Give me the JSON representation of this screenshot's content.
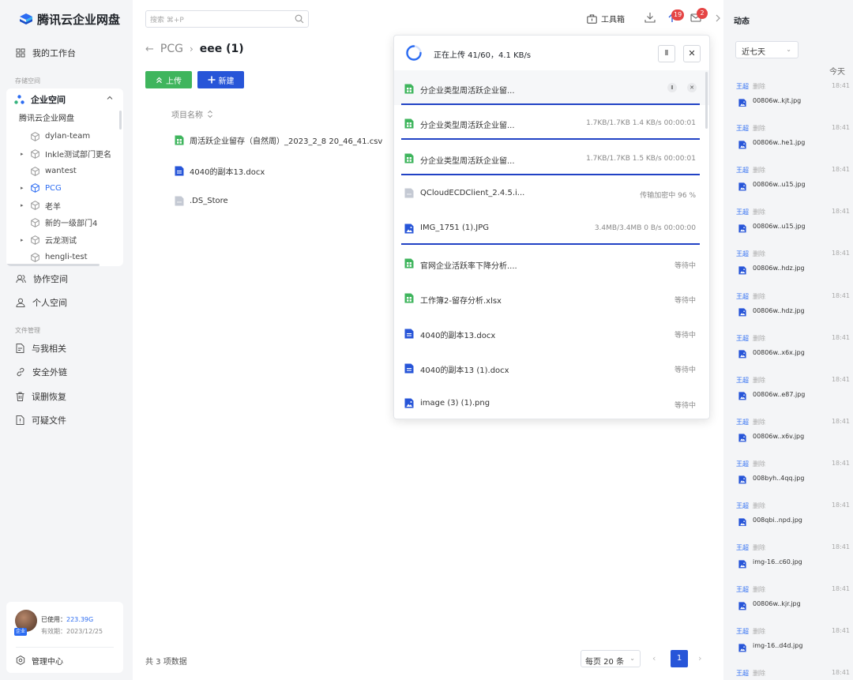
{
  "app": {
    "title": "腾讯云企业网盘"
  },
  "sidebar": {
    "workbench": "我的工作台",
    "storage_label": "存储空间",
    "enterprise_space": "企业空间",
    "tree_root": "腾讯云企业网盘",
    "tree": [
      {
        "label": "dylan-team",
        "arrow": ""
      },
      {
        "label": "Inkle测试部门更名",
        "arrow": "▸"
      },
      {
        "label": "wantest",
        "arrow": ""
      },
      {
        "label": "PCG",
        "arrow": "▸",
        "selected": true
      },
      {
        "label": "老羊",
        "arrow": "▸"
      },
      {
        "label": "新的一级部门4",
        "arrow": ""
      },
      {
        "label": "云龙测试",
        "arrow": "▸"
      },
      {
        "label": "hengli-test",
        "arrow": ""
      }
    ],
    "collab_space": "协作空间",
    "personal_space": "个人空间",
    "file_mgmt_label": "文件管理",
    "related": "与我相关",
    "secure_links": "安全外链",
    "recycle": "误删恢复",
    "suspicious": "可疑文件",
    "user": {
      "used_label": "已使用：",
      "used_value": "223.39G",
      "expire": "有效期：2023/12/25",
      "badge": "企业"
    },
    "admin_center": "管理中心"
  },
  "header": {
    "search_placeholder": "搜索 ⌘+P",
    "toolbox": "工具箱",
    "upload_badge": "19",
    "message_badge": "2"
  },
  "breadcrumb": {
    "parent": "PCG",
    "current": "eee (1)"
  },
  "actions": {
    "upload": "上传",
    "new": "新建"
  },
  "files": {
    "column_name": "项目名称",
    "items": [
      {
        "name": "周活跃企业留存（自然周）_2023_2_8 20_46_41.csv",
        "type": "sheet"
      },
      {
        "name": "4040的副本13.docx",
        "type": "doc"
      },
      {
        "name": ".DS_Store",
        "type": "other"
      }
    ],
    "total": "共 3 项数据"
  },
  "pagination": {
    "page_size": "每页 20 条",
    "current_page": "1"
  },
  "upload_panel": {
    "status": "正在上传 41/60，4.1 KB/s",
    "items": [
      {
        "name": "分企业类型周活跃企业留...",
        "status": "",
        "type": "sheet",
        "progress": 1,
        "controls": true
      },
      {
        "name": "分企业类型周活跃企业留...",
        "status": "1.7KB/1.7KB 1.4 KB/s 00:00:01",
        "type": "sheet",
        "progress": 1
      },
      {
        "name": "分企业类型周活跃企业留...",
        "status": "1.7KB/1.7KB 1.5 KB/s 00:00:01",
        "type": "sheet",
        "progress": 1
      },
      {
        "name": "QCloudECDClient_2.4.5.i...",
        "status": "传输加密中 96 %",
        "type": "other",
        "progress": 0
      },
      {
        "name": "IMG_1751 (1).JPG",
        "status": "3.4MB/3.4MB 0 B/s 00:00:00",
        "type": "image",
        "progress": 1
      },
      {
        "name": "官网企业活跃率下降分析....",
        "status": "等待中",
        "type": "sheet",
        "progress": 0
      },
      {
        "name": "工作簿2-留存分析.xlsx",
        "status": "等待中",
        "type": "sheet",
        "progress": 0
      },
      {
        "name": "4040的副本13.docx",
        "status": "等待中",
        "type": "doc",
        "progress": 0
      },
      {
        "name": "4040的副本13 (1).docx",
        "status": "等待中",
        "type": "doc",
        "progress": 0
      },
      {
        "name": "image (3) (1).png",
        "status": "等待中",
        "type": "image",
        "progress": 0
      }
    ]
  },
  "activity": {
    "title": "动态",
    "range": "近七天",
    "today": "今天",
    "items": [
      {
        "user": "王超",
        "action": "删除",
        "time": "18:41",
        "file": "00806w..kjt.jpg"
      },
      {
        "user": "王超",
        "action": "删除",
        "time": "18:41",
        "file": "00806w..he1.jpg"
      },
      {
        "user": "王超",
        "action": "删除",
        "time": "18:41",
        "file": "00806w..u15.jpg"
      },
      {
        "user": "王超",
        "action": "删除",
        "time": "18:41",
        "file": "00806w..u15.jpg"
      },
      {
        "user": "王超",
        "action": "删除",
        "time": "18:41",
        "file": "00806w..hdz.jpg"
      },
      {
        "user": "王超",
        "action": "删除",
        "time": "18:41",
        "file": "00806w..hdz.jpg"
      },
      {
        "user": "王超",
        "action": "删除",
        "time": "18:41",
        "file": "00806w..x6x.jpg"
      },
      {
        "user": "王超",
        "action": "删除",
        "time": "18:41",
        "file": "00806w..e87.jpg"
      },
      {
        "user": "王超",
        "action": "删除",
        "time": "18:41",
        "file": "00806w..x6v.jpg"
      },
      {
        "user": "王超",
        "action": "删除",
        "time": "18:41",
        "file": "008byh..4qq.jpg"
      },
      {
        "user": "王超",
        "action": "删除",
        "time": "18:41",
        "file": "008qbi..npd.jpg"
      },
      {
        "user": "王超",
        "action": "删除",
        "time": "18:41",
        "file": "img-16..c60.jpg"
      },
      {
        "user": "王超",
        "action": "删除",
        "time": "18:41",
        "file": "00806w..kjr.jpg"
      },
      {
        "user": "王超",
        "action": "删除",
        "time": "18:41",
        "file": "img-16..d4d.jpg"
      },
      {
        "user": "王超",
        "action": "删除",
        "time": "18:41",
        "file": ""
      }
    ]
  },
  "colors": {
    "accent": "#2c6cf2",
    "upload_green": "#3fb55d",
    "primary_blue": "#2755d8",
    "badge_red": "#e54545",
    "progress_blue": "#2142c5"
  }
}
